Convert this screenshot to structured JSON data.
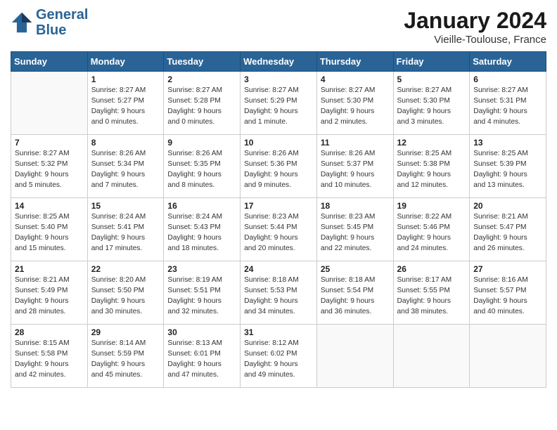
{
  "header": {
    "logo_line1": "General",
    "logo_line2": "Blue",
    "month_title": "January 2024",
    "subtitle": "Vieille-Toulouse, France"
  },
  "days_of_week": [
    "Sunday",
    "Monday",
    "Tuesday",
    "Wednesday",
    "Thursday",
    "Friday",
    "Saturday"
  ],
  "weeks": [
    [
      {
        "day": "",
        "text": ""
      },
      {
        "day": "1",
        "text": "Sunrise: 8:27 AM\nSunset: 5:27 PM\nDaylight: 9 hours\nand 0 minutes."
      },
      {
        "day": "2",
        "text": "Sunrise: 8:27 AM\nSunset: 5:28 PM\nDaylight: 9 hours\nand 0 minutes."
      },
      {
        "day": "3",
        "text": "Sunrise: 8:27 AM\nSunset: 5:29 PM\nDaylight: 9 hours\nand 1 minute."
      },
      {
        "day": "4",
        "text": "Sunrise: 8:27 AM\nSunset: 5:30 PM\nDaylight: 9 hours\nand 2 minutes."
      },
      {
        "day": "5",
        "text": "Sunrise: 8:27 AM\nSunset: 5:30 PM\nDaylight: 9 hours\nand 3 minutes."
      },
      {
        "day": "6",
        "text": "Sunrise: 8:27 AM\nSunset: 5:31 PM\nDaylight: 9 hours\nand 4 minutes."
      }
    ],
    [
      {
        "day": "7",
        "text": "Sunrise: 8:27 AM\nSunset: 5:32 PM\nDaylight: 9 hours\nand 5 minutes."
      },
      {
        "day": "8",
        "text": "Sunrise: 8:26 AM\nSunset: 5:34 PM\nDaylight: 9 hours\nand 7 minutes."
      },
      {
        "day": "9",
        "text": "Sunrise: 8:26 AM\nSunset: 5:35 PM\nDaylight: 9 hours\nand 8 minutes."
      },
      {
        "day": "10",
        "text": "Sunrise: 8:26 AM\nSunset: 5:36 PM\nDaylight: 9 hours\nand 9 minutes."
      },
      {
        "day": "11",
        "text": "Sunrise: 8:26 AM\nSunset: 5:37 PM\nDaylight: 9 hours\nand 10 minutes."
      },
      {
        "day": "12",
        "text": "Sunrise: 8:25 AM\nSunset: 5:38 PM\nDaylight: 9 hours\nand 12 minutes."
      },
      {
        "day": "13",
        "text": "Sunrise: 8:25 AM\nSunset: 5:39 PM\nDaylight: 9 hours\nand 13 minutes."
      }
    ],
    [
      {
        "day": "14",
        "text": "Sunrise: 8:25 AM\nSunset: 5:40 PM\nDaylight: 9 hours\nand 15 minutes."
      },
      {
        "day": "15",
        "text": "Sunrise: 8:24 AM\nSunset: 5:41 PM\nDaylight: 9 hours\nand 17 minutes."
      },
      {
        "day": "16",
        "text": "Sunrise: 8:24 AM\nSunset: 5:43 PM\nDaylight: 9 hours\nand 18 minutes."
      },
      {
        "day": "17",
        "text": "Sunrise: 8:23 AM\nSunset: 5:44 PM\nDaylight: 9 hours\nand 20 minutes."
      },
      {
        "day": "18",
        "text": "Sunrise: 8:23 AM\nSunset: 5:45 PM\nDaylight: 9 hours\nand 22 minutes."
      },
      {
        "day": "19",
        "text": "Sunrise: 8:22 AM\nSunset: 5:46 PM\nDaylight: 9 hours\nand 24 minutes."
      },
      {
        "day": "20",
        "text": "Sunrise: 8:21 AM\nSunset: 5:47 PM\nDaylight: 9 hours\nand 26 minutes."
      }
    ],
    [
      {
        "day": "21",
        "text": "Sunrise: 8:21 AM\nSunset: 5:49 PM\nDaylight: 9 hours\nand 28 minutes."
      },
      {
        "day": "22",
        "text": "Sunrise: 8:20 AM\nSunset: 5:50 PM\nDaylight: 9 hours\nand 30 minutes."
      },
      {
        "day": "23",
        "text": "Sunrise: 8:19 AM\nSunset: 5:51 PM\nDaylight: 9 hours\nand 32 minutes."
      },
      {
        "day": "24",
        "text": "Sunrise: 8:18 AM\nSunset: 5:53 PM\nDaylight: 9 hours\nand 34 minutes."
      },
      {
        "day": "25",
        "text": "Sunrise: 8:18 AM\nSunset: 5:54 PM\nDaylight: 9 hours\nand 36 minutes."
      },
      {
        "day": "26",
        "text": "Sunrise: 8:17 AM\nSunset: 5:55 PM\nDaylight: 9 hours\nand 38 minutes."
      },
      {
        "day": "27",
        "text": "Sunrise: 8:16 AM\nSunset: 5:57 PM\nDaylight: 9 hours\nand 40 minutes."
      }
    ],
    [
      {
        "day": "28",
        "text": "Sunrise: 8:15 AM\nSunset: 5:58 PM\nDaylight: 9 hours\nand 42 minutes."
      },
      {
        "day": "29",
        "text": "Sunrise: 8:14 AM\nSunset: 5:59 PM\nDaylight: 9 hours\nand 45 minutes."
      },
      {
        "day": "30",
        "text": "Sunrise: 8:13 AM\nSunset: 6:01 PM\nDaylight: 9 hours\nand 47 minutes."
      },
      {
        "day": "31",
        "text": "Sunrise: 8:12 AM\nSunset: 6:02 PM\nDaylight: 9 hours\nand 49 minutes."
      },
      {
        "day": "",
        "text": ""
      },
      {
        "day": "",
        "text": ""
      },
      {
        "day": "",
        "text": ""
      }
    ]
  ]
}
